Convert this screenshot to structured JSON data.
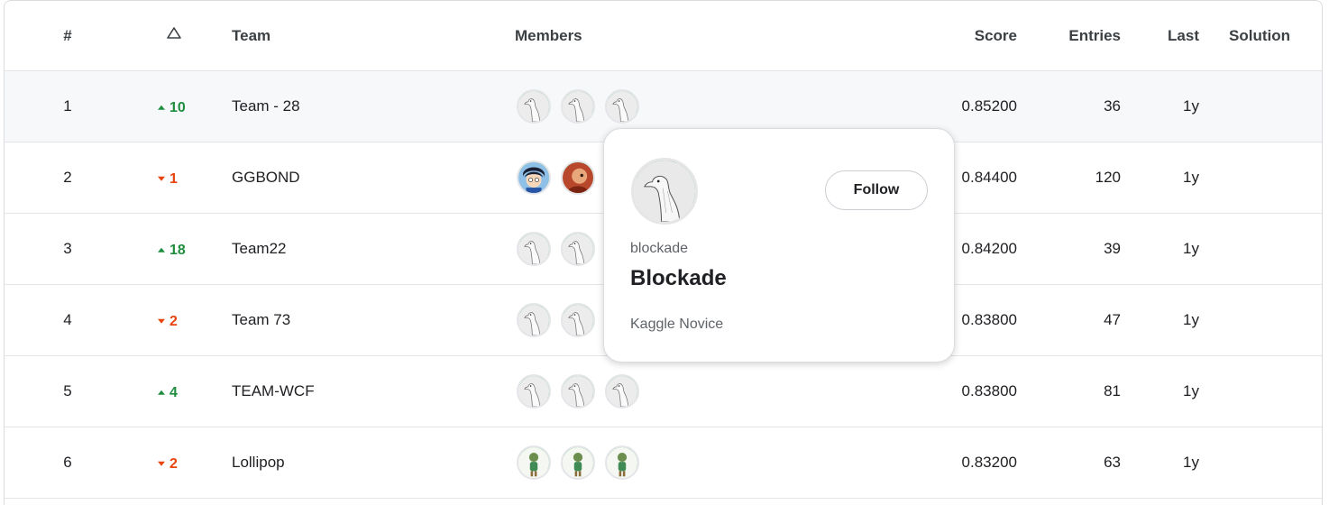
{
  "header": {
    "rank": "#",
    "team": "Team",
    "members": "Members",
    "score": "Score",
    "entries": "Entries",
    "last": "Last",
    "solution": "Solution",
    "delta_icon": "triangle-outline-icon"
  },
  "rows": [
    {
      "rank": "1",
      "delta": "10",
      "direction": "up",
      "team": "Team - 28",
      "score": "0.85200",
      "entries": "36",
      "last": "1y",
      "avatars": [
        "goose",
        "goose",
        "goose"
      ]
    },
    {
      "rank": "2",
      "delta": "1",
      "direction": "down",
      "team": "GGBOND",
      "score": "0.84400",
      "entries": "120",
      "last": "1y",
      "avatars": [
        "anime",
        "red"
      ]
    },
    {
      "rank": "3",
      "delta": "18",
      "direction": "up",
      "team": "Team22",
      "score": "0.84200",
      "entries": "39",
      "last": "1y",
      "avatars": [
        "goose",
        "goose"
      ]
    },
    {
      "rank": "4",
      "delta": "2",
      "direction": "down",
      "team": "Team 73",
      "score": "0.83800",
      "entries": "47",
      "last": "1y",
      "avatars": [
        "goose",
        "goose"
      ]
    },
    {
      "rank": "5",
      "delta": "4",
      "direction": "up",
      "team": "TEAM-WCF",
      "score": "0.83800",
      "entries": "81",
      "last": "1y",
      "avatars": [
        "goose",
        "goose",
        "goose"
      ]
    },
    {
      "rank": "6",
      "delta": "2",
      "direction": "down",
      "team": "Lollipop",
      "score": "0.83200",
      "entries": "63",
      "last": "1y",
      "avatars": [
        "cartoon",
        "cartoon",
        "cartoon"
      ]
    }
  ],
  "popup": {
    "username": "blockade",
    "display_name": "Blockade",
    "tier": "Kaggle Novice",
    "follow_label": "Follow"
  },
  "colors": {
    "up": "#1e8e3e",
    "down": "#e8430f",
    "progress_arc": "#20a94a",
    "row_highlight": "#f7f8fa"
  }
}
